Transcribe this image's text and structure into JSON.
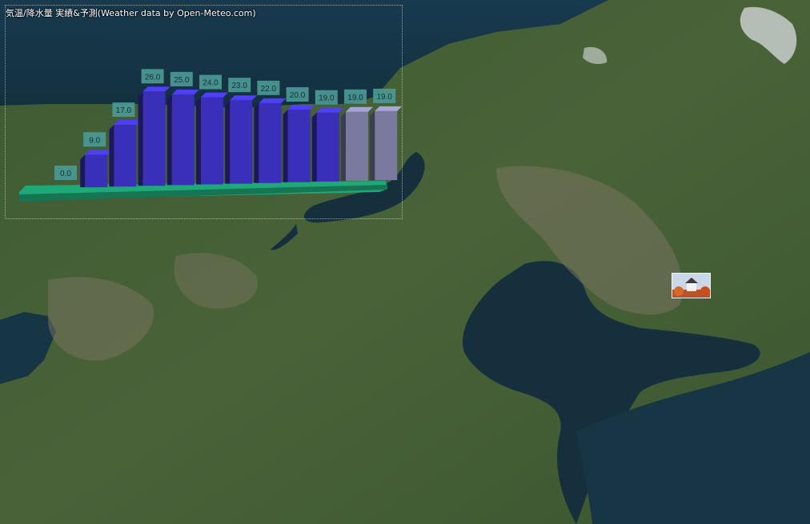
{
  "title": "気温/降水量 実績&予測(Weather data by Open-Meteo.com)",
  "colors": {
    "bar_actual": "#3a2fb8",
    "bar_forecast": "#7a7aa0",
    "base_plate": "#1fa878",
    "label_bg": "#4b9a98"
  },
  "marker": {
    "icon": "castle-photo-icon"
  },
  "chart_data": {
    "type": "bar",
    "categories": [
      "",
      "",
      "",
      "",
      "",
      "",
      "",
      "",
      "",
      "",
      "",
      ""
    ],
    "series": [
      {
        "values": [
          0.0,
          9.0,
          17.0,
          26.0,
          25.0,
          24.0,
          23.0,
          22.0,
          20.0,
          19.0,
          19.0,
          19.0
        ]
      }
    ],
    "value_labels": [
      "0.0",
      "9.0",
      "17.0",
      "26.0",
      "25.0",
      "24.0",
      "23.0",
      "22.0",
      "20.0",
      "19.0",
      "19.0",
      "19.0"
    ],
    "forecast_from_index": 10,
    "title": "",
    "xlabel": "",
    "ylabel": "",
    "ylim": [
      0,
      26
    ]
  }
}
